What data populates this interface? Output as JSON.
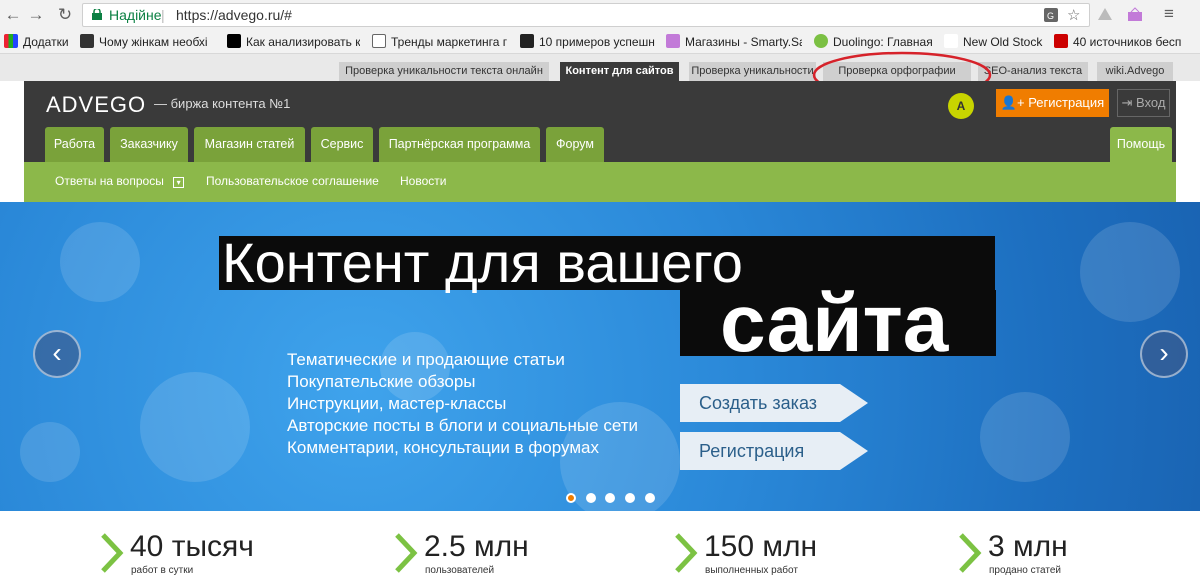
{
  "browser": {
    "secure_label": "Надійне",
    "url": "https://advego.ru/#"
  },
  "bookmarks": [
    {
      "label": "Додатки",
      "color": "#e23"
    },
    {
      "label": "Чому жінкам необхі",
      "color": "#333"
    },
    {
      "label": "Как анализировать к",
      "color": "#000"
    },
    {
      "label": "Тренды маркетинга г",
      "color": "#666"
    },
    {
      "label": "10 примеров успешн",
      "color": "#222"
    },
    {
      "label": "Магазины - Smarty.Sa",
      "color": "#c27ad8"
    },
    {
      "label": "Duolingo: Главная",
      "color": "#7bc043"
    },
    {
      "label": "New Old Stock",
      "color": "#222"
    },
    {
      "label": "40 источников бесп",
      "color": "#c00"
    }
  ],
  "site_tabs": [
    {
      "label": "Проверка уникальности текста онлайн"
    },
    {
      "label": "Контент для сайтов"
    },
    {
      "label": "Проверка уникальности"
    },
    {
      "label": "Проверка орфографии"
    },
    {
      "label": "SEO-анализ текста"
    },
    {
      "label": "wiki.Advego"
    }
  ],
  "header": {
    "logo": "ADVEGO",
    "tagline": "—   биржа контента №1",
    "badge": "A",
    "register_label": "Регистрация",
    "login_label": "Вход"
  },
  "main_tabs": [
    "Работа",
    "Заказчику",
    "Магазин статей",
    "Сервис",
    "Партнёрская программа",
    "Форум"
  ],
  "help_tab": "Помощь",
  "subnav": [
    "Ответы на вопросы",
    "Пользовательское соглашение",
    "Новости"
  ],
  "hero": {
    "line1": "Контент для вашего",
    "line2": "сайта",
    "features": [
      "Тематические и продающие статьи",
      "Покупательские обзоры",
      "Инструкции, мастер-классы",
      "Авторские посты в блоги и социальные сети",
      "Комментарии, консультации в форумах"
    ],
    "cta_order": "Создать заказ",
    "cta_register": "Регистрация"
  },
  "stats": [
    {
      "number": "40 тысяч",
      "label": "работ в сутки"
    },
    {
      "number": "2.5 млн",
      "label": "пользователей"
    },
    {
      "number": "150 млн",
      "label": "выполненных работ"
    },
    {
      "number": "3 млн",
      "label": "продано статей"
    }
  ],
  "colors": {
    "accent_orange": "#f07d00",
    "nav_green": "#7aa23a",
    "header_dark": "#3a3a3a",
    "secure_green": "#0b8043"
  }
}
